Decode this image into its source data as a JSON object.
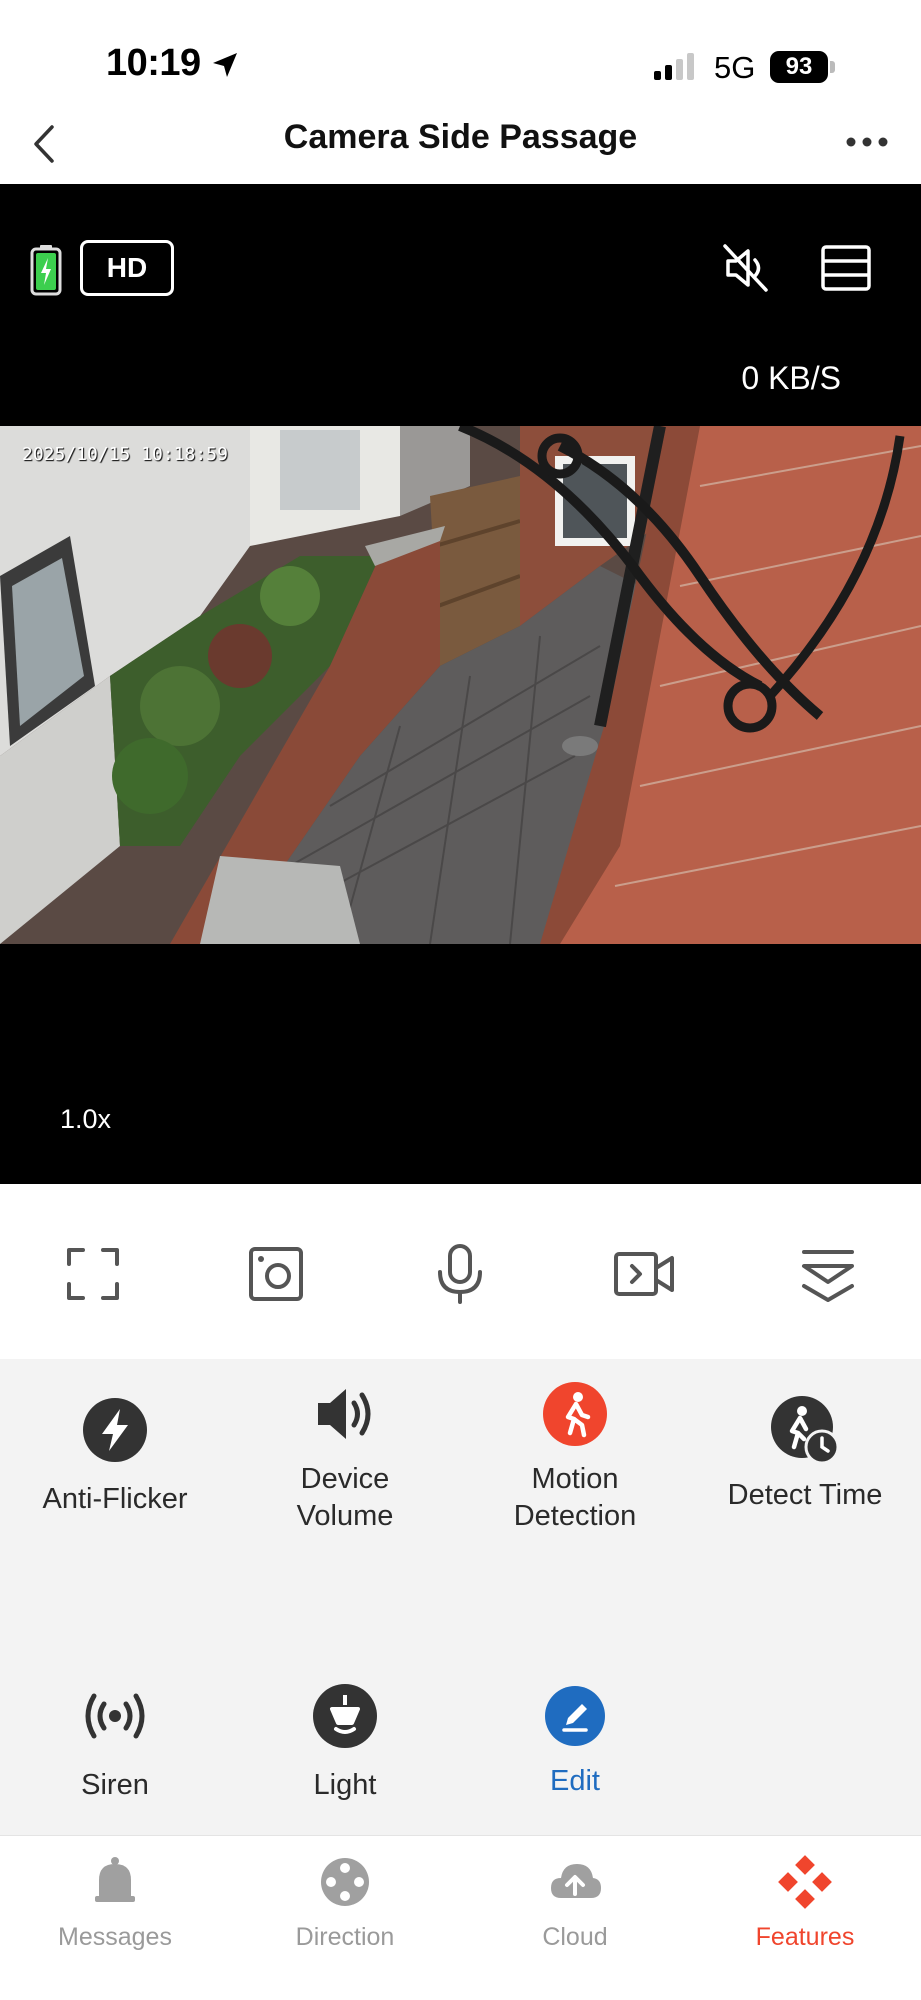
{
  "status_bar": {
    "time": "10:19",
    "network": "5G",
    "battery": "93"
  },
  "header": {
    "title": "Camera Side Passage"
  },
  "video": {
    "quality_badge": "HD",
    "speed": "0 KB/S",
    "zoom": "1.0x",
    "timestamp": "2025/10/15 10:18:59"
  },
  "controls": [
    {
      "icon": "fullscreen-icon"
    },
    {
      "icon": "screenshot-icon"
    },
    {
      "icon": "microphone-icon"
    },
    {
      "icon": "record-video-icon"
    },
    {
      "icon": "collapse-icon"
    }
  ],
  "features": [
    {
      "label": "Anti-Flicker",
      "icon": "anti-flicker-icon"
    },
    {
      "label": "Device Volume",
      "icon": "volume-icon"
    },
    {
      "label": "Motion Detection",
      "icon": "motion-detection-icon",
      "color": "#f0452d"
    },
    {
      "label": "Detect Time",
      "icon": "detect-time-icon"
    },
    {
      "label": "Siren",
      "icon": "siren-icon"
    },
    {
      "label": "Light",
      "icon": "light-icon"
    },
    {
      "label": "Edit",
      "icon": "edit-icon",
      "color": "#1f6cc0"
    }
  ],
  "tabs": [
    {
      "label": "Messages",
      "icon": "bell-icon"
    },
    {
      "label": "Direction",
      "icon": "direction-icon"
    },
    {
      "label": "Cloud",
      "icon": "cloud-upload-icon"
    },
    {
      "label": "Features",
      "icon": "features-icon",
      "active": true
    }
  ],
  "colors": {
    "accent": "#f0452d",
    "edit_blue": "#1f6cc0",
    "panel_bg": "#f3f3f3",
    "battery_green": "#3ccf4e"
  }
}
